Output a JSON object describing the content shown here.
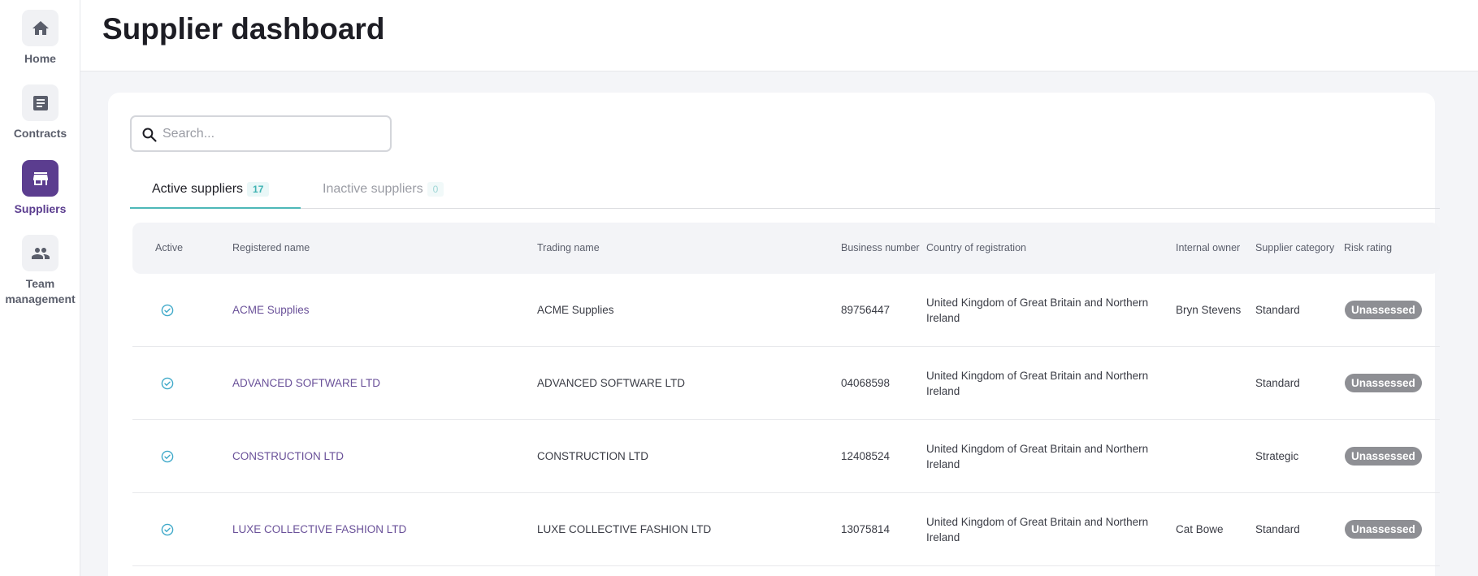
{
  "sidebar": {
    "items": [
      {
        "label": "Home",
        "icon": "home-icon"
      },
      {
        "label": "Contracts",
        "icon": "document-icon"
      },
      {
        "label": "Suppliers",
        "icon": "store-icon",
        "active": true
      },
      {
        "label": "Team management",
        "icon": "people-icon"
      }
    ]
  },
  "header": {
    "title": "Supplier dashboard"
  },
  "search": {
    "placeholder": "Search...",
    "value": ""
  },
  "tabs": [
    {
      "label": "Active suppliers",
      "count": "17",
      "active": true
    },
    {
      "label": "Inactive suppliers",
      "count": "0",
      "active": false
    }
  ],
  "table": {
    "columns": [
      "Active",
      "Registered name",
      "Trading name",
      "Business number",
      "Country of registration",
      "Internal owner",
      "Supplier category",
      "Risk rating"
    ],
    "rows": [
      {
        "registered_name": "ACME Supplies",
        "trading_name": "ACME Supplies",
        "business_number": "89756447",
        "country": "United Kingdom of Great Britain and Northern Ireland",
        "owner": "Bryn Stevens",
        "category": "Standard",
        "risk": "Unassessed"
      },
      {
        "registered_name": "ADVANCED SOFTWARE LTD",
        "trading_name": "ADVANCED SOFTWARE LTD",
        "business_number": "04068598",
        "country": "United Kingdom of Great Britain and Northern Ireland",
        "owner": "",
        "category": "Standard",
        "risk": "Unassessed"
      },
      {
        "registered_name": "CONSTRUCTION LTD",
        "trading_name": "CONSTRUCTION LTD",
        "business_number": "12408524",
        "country": "United Kingdom of Great Britain and Northern Ireland",
        "owner": "",
        "category": "Strategic",
        "risk": "Unassessed"
      },
      {
        "registered_name": "LUXE COLLECTIVE FASHION LTD",
        "trading_name": "LUXE COLLECTIVE FASHION LTD",
        "business_number": "13075814",
        "country": "United Kingdom of Great Britain and Northern Ireland",
        "owner": "Cat Bowe",
        "category": "Standard",
        "risk": "Unassessed"
      }
    ]
  },
  "colors": {
    "accent": "#5b3d8f",
    "teal": "#4db8b8",
    "badge_gray": "#8e8f94"
  }
}
